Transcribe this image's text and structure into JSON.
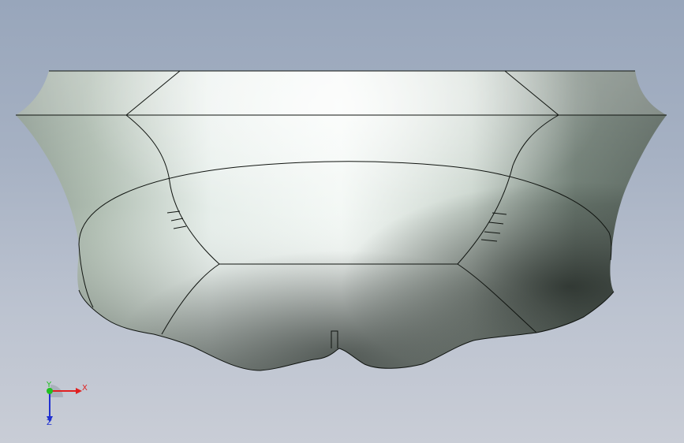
{
  "viewport": {
    "background_top": "#98a6bb",
    "background_bottom": "#c9cdd6"
  },
  "model": {
    "surface_light": "#eaf2ee",
    "surface_mid": "#b7c4b8",
    "surface_dark": "#3f4a44",
    "edge_color": "#101410"
  },
  "triad": {
    "x_label": "X",
    "y_label": "Y",
    "z_label": "Z",
    "x_color": "#e02020",
    "y_color": "#20c020",
    "z_color": "#2030d0"
  }
}
